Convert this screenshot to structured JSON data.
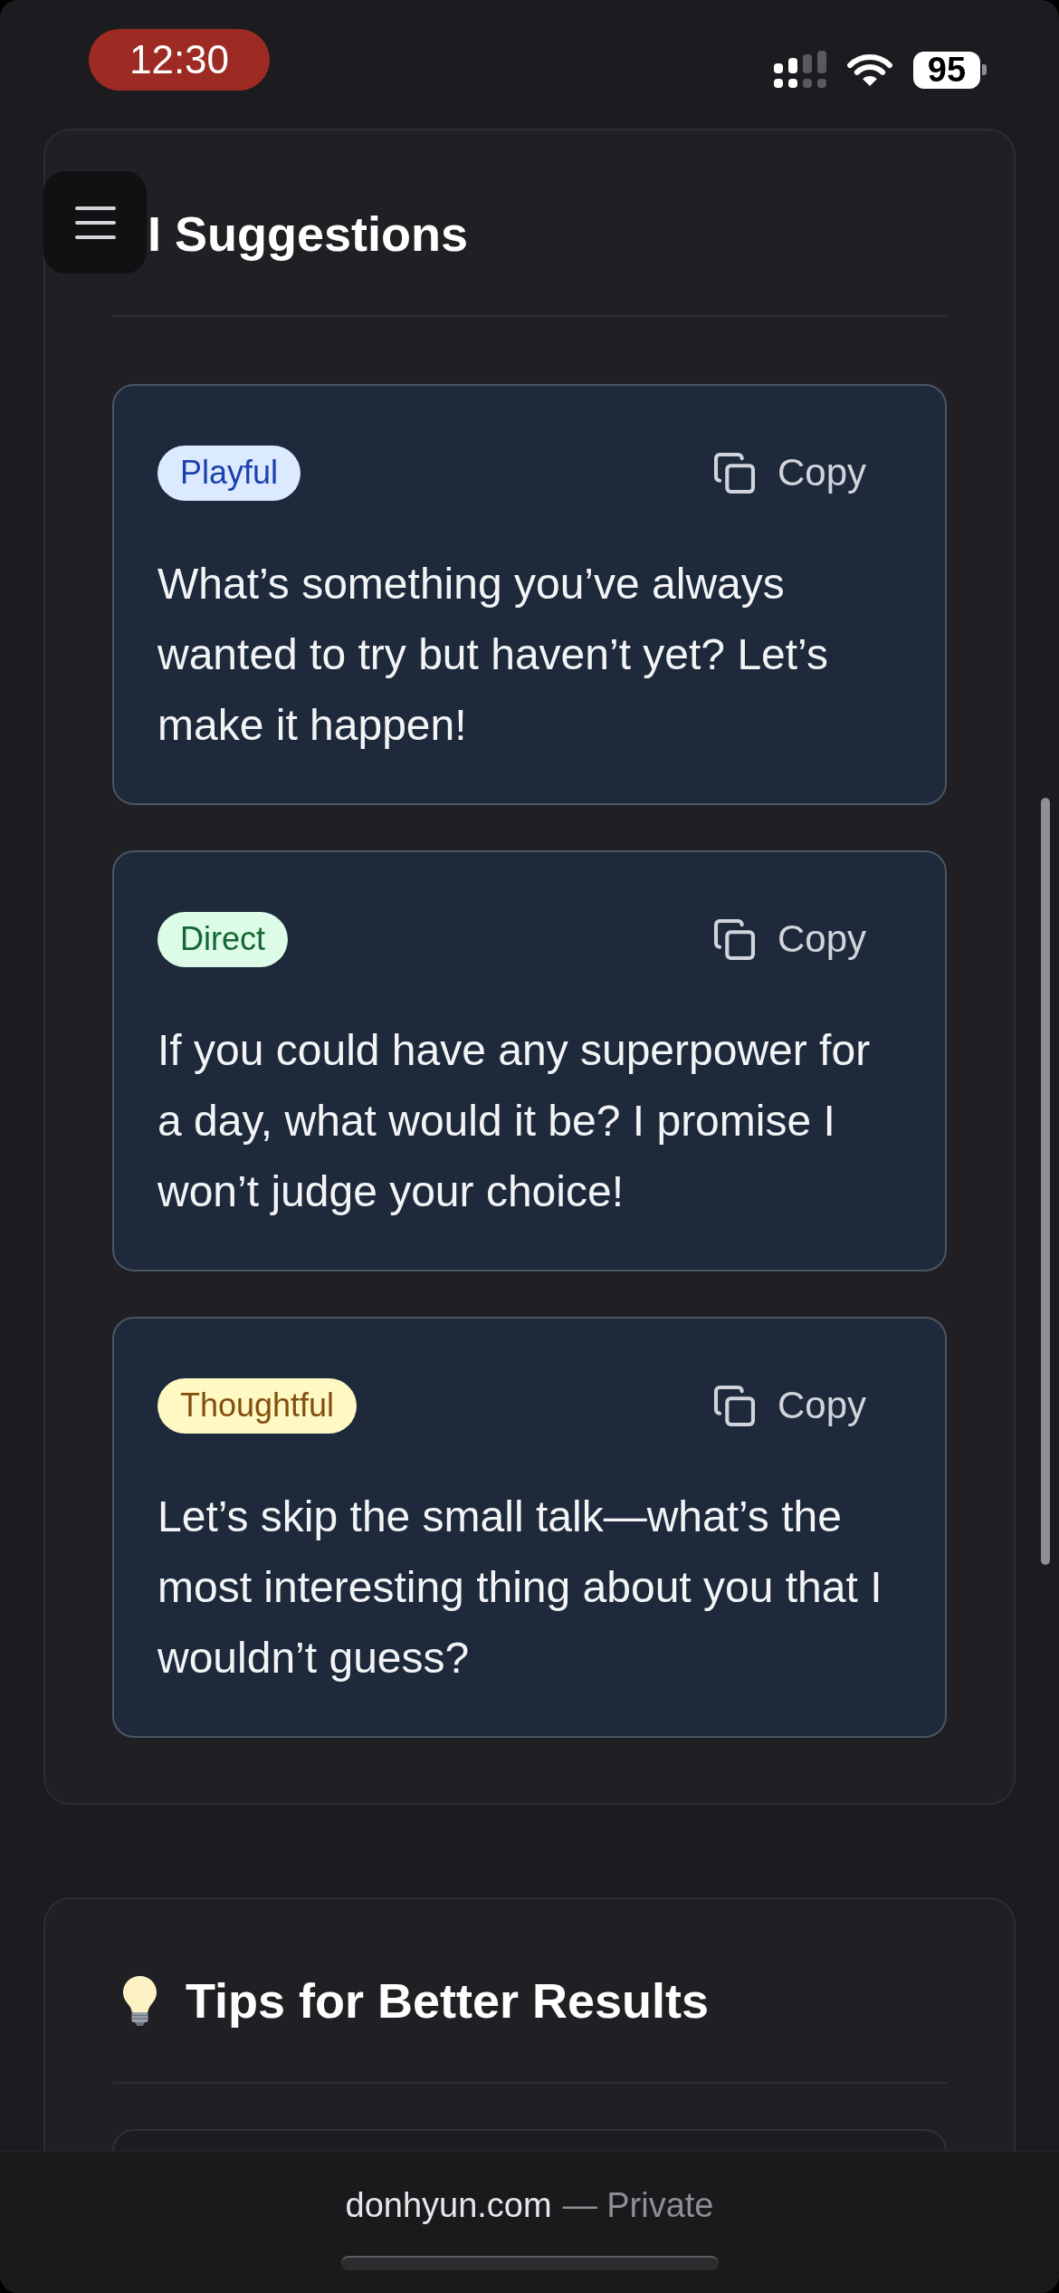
{
  "status_bar": {
    "time": "12:30",
    "battery": "95"
  },
  "suggestions_panel": {
    "title": "I Suggestions",
    "suggestions": [
      {
        "tag": "Playful",
        "color": "#dbeafe",
        "copy_label": "Copy",
        "text": "What’s something you’ve always wanted to try but haven’t yet? Let’s make it happen!"
      },
      {
        "tag": "Direct",
        "color": "#dcfce7",
        "copy_label": "Copy",
        "text": "If you could have any superpower for a day, what would it be? I promise I won’t judge your choice!"
      },
      {
        "tag": "Thoughtful",
        "color": "#fef9c3",
        "copy_label": "Copy",
        "text": "Let’s skip the small talk—what’s the most interesting thing about you that I wouldn’t guess?"
      }
    ]
  },
  "tips_panel": {
    "title": "Tips for Better Results"
  },
  "address_bar": {
    "domain": "donhyun.com",
    "mode": "— Private"
  }
}
